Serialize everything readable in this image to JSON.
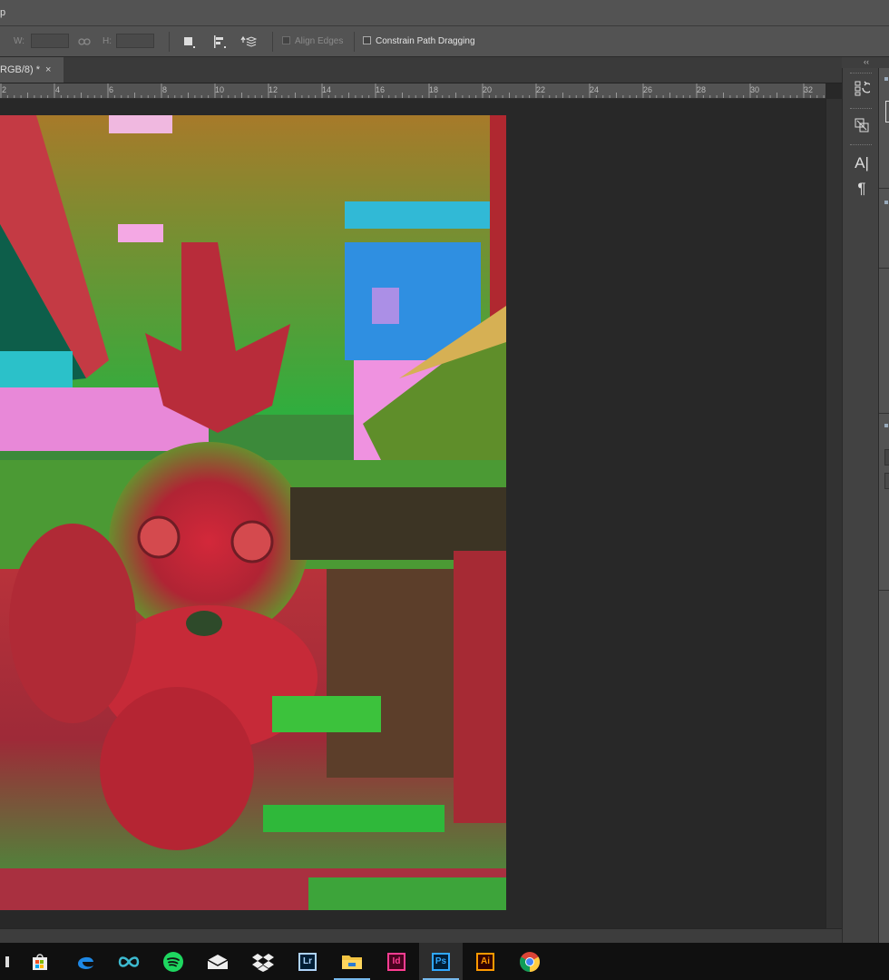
{
  "menubar": {
    "fragment": "p"
  },
  "options": {
    "w_label": "W:",
    "h_label": "H:",
    "align_edges_label": "Align Edges",
    "constrain_label": "Constrain Path Dragging"
  },
  "document_tab": {
    "title": "RGB/8) *",
    "close_glyph": "×"
  },
  "ruler": {
    "unit_labels": [
      "2",
      "4",
      "6",
      "8",
      "10",
      "12",
      "14",
      "16",
      "18",
      "20",
      "22",
      "24",
      "26",
      "28",
      "30",
      "32"
    ]
  },
  "panels": {
    "collapse_glyph": "‹‹",
    "character_icon_text": "A|",
    "paragraph_icon_text": "¶"
  },
  "taskbar": {
    "apps": [
      {
        "name": "cmd-prompt",
        "label": ""
      },
      {
        "name": "store",
        "label": ""
      },
      {
        "name": "edge",
        "label": ""
      },
      {
        "name": "infinity",
        "label": ""
      },
      {
        "name": "spotify",
        "label": ""
      },
      {
        "name": "mail",
        "label": ""
      },
      {
        "name": "dropbox",
        "label": ""
      },
      {
        "name": "lightroom",
        "label": "Lr"
      },
      {
        "name": "file-explorer",
        "label": ""
      },
      {
        "name": "indesign",
        "label": "Id"
      },
      {
        "name": "photoshop",
        "label": "Ps"
      },
      {
        "name": "illustrator",
        "label": "Ai"
      },
      {
        "name": "chrome",
        "label": ""
      }
    ],
    "colors": {
      "lightroom": "#aed2f8",
      "indesign": "#ff3d92",
      "photoshop": "#31a8ff",
      "illustrator": "#ff9a00"
    }
  }
}
